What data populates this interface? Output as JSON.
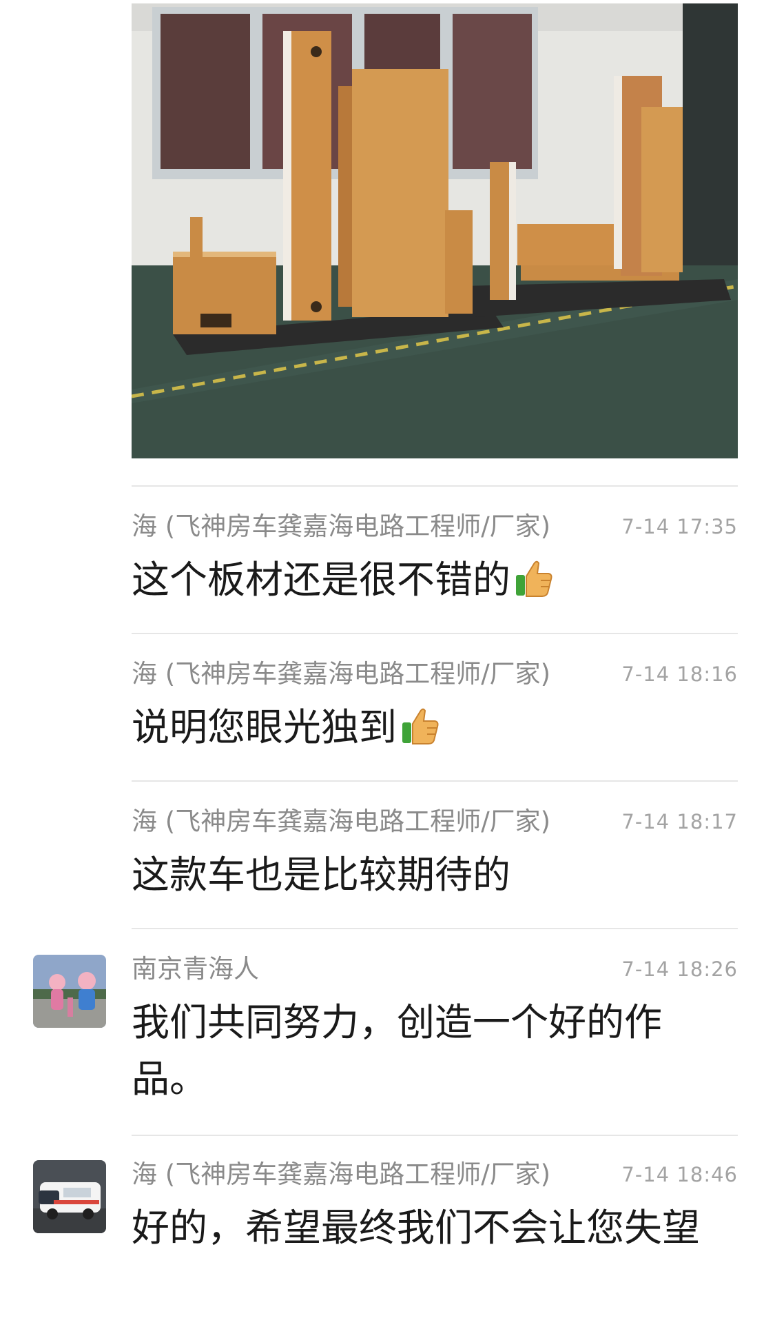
{
  "chat": {
    "messages": [
      {
        "sender": "海 (飞神房车龚嘉海电路工程师/厂家)",
        "time": "7-14 17:35",
        "text": "这个板材还是很不错的",
        "emoji": "thumbs-up-icon"
      },
      {
        "sender": "海 (飞神房车龚嘉海电路工程师/厂家)",
        "time": "7-14 18:16",
        "text": "说明您眼光独到",
        "emoji": "thumbs-up-icon"
      },
      {
        "sender": "海 (飞神房车龚嘉海电路工程师/厂家)",
        "time": "7-14 18:17",
        "text": "这款车也是比较期待的"
      },
      {
        "sender": "南京青海人",
        "time": "7-14 18:26",
        "text": "我们共同努力，创造一个好的作品。",
        "avatar": "avatar-cartoon-figures"
      },
      {
        "sender": "海 (飞神房车龚嘉海电路工程师/厂家)",
        "time": "7-14 18:46",
        "text": "好的，希望最终我们不会让您失望",
        "avatar": "avatar-rv-van"
      }
    ]
  },
  "colors": {
    "sender": "#8a8a8a",
    "time": "#a3a3a3",
    "text": "#1a1a1a",
    "divider": "#e6e6e6"
  }
}
